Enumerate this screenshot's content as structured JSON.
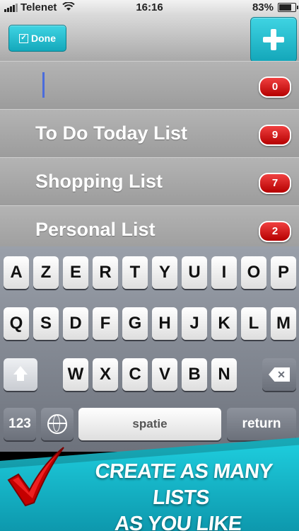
{
  "status_bar": {
    "carrier": "Telenet",
    "time": "16:16",
    "battery_percent": "83%",
    "battery_level": 0.83,
    "icons": [
      "signal-bars-icon",
      "wifi-icon",
      "battery-icon"
    ]
  },
  "navbar": {
    "done_label": "Done",
    "add_icon": "plus-icon"
  },
  "lists": [
    {
      "label": "",
      "count": "0",
      "editing": true
    },
    {
      "label": "To Do Today List",
      "count": "9"
    },
    {
      "label": "Shopping List",
      "count": "7"
    },
    {
      "label": "Personal List",
      "count": "2"
    }
  ],
  "keyboard": {
    "row1": [
      "A",
      "Z",
      "E",
      "R",
      "T",
      "Y",
      "U",
      "I",
      "O",
      "P"
    ],
    "row2": [
      "Q",
      "S",
      "D",
      "F",
      "G",
      "H",
      "J",
      "K",
      "L",
      "M"
    ],
    "row3": [
      "W",
      "X",
      "C",
      "V",
      "B",
      "N"
    ],
    "numbers_label": "123",
    "space_label": "spatie",
    "return_label": "return",
    "icons": [
      "shift-icon",
      "backspace-icon",
      "globe-icon"
    ]
  },
  "banner": {
    "line1": "CREATE AS MANY LISTS",
    "line2": "AS YOU LIKE",
    "icon": "red-checkmark-icon"
  },
  "colors": {
    "accent": "#1fc6d8",
    "badge_red": "#d01010",
    "cursor_blue": "#4a6cdc"
  }
}
